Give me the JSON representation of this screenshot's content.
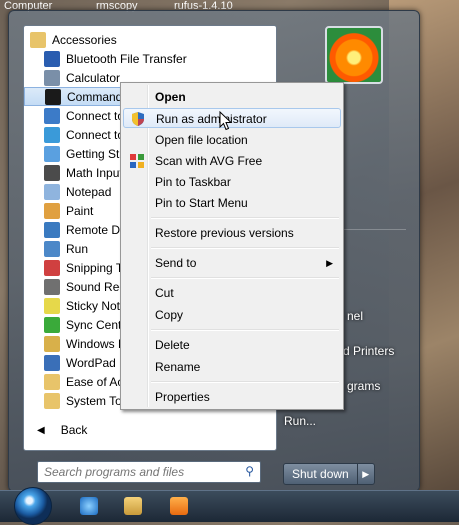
{
  "desktop": {
    "top_items": [
      "Computer",
      "rmscopy",
      "rufus-1.4.10"
    ]
  },
  "programs": [
    {
      "label": "Accessories",
      "icon": "folder-icon",
      "color": "#e8c46a"
    },
    {
      "label": "Bluetooth File Transfer",
      "icon": "bluetooth-icon",
      "color": "#2a5db0"
    },
    {
      "label": "Calculator",
      "icon": "calculator-icon",
      "color": "#7a8fa8"
    },
    {
      "label": "Command Prompt",
      "icon": "cmd-icon",
      "color": "#1a1a1a"
    },
    {
      "label": "Connect to",
      "icon": "network-projector-icon",
      "color": "#3c7bc8"
    },
    {
      "label": "Connect to",
      "icon": "remote-display-icon",
      "color": "#3a9ad9"
    },
    {
      "label": "Getting Star",
      "icon": "getting-started-icon",
      "color": "#5aa0e0"
    },
    {
      "label": "Math Input",
      "icon": "math-input-icon",
      "color": "#4b4b4b"
    },
    {
      "label": "Notepad",
      "icon": "notepad-icon",
      "color": "#8fb4de"
    },
    {
      "label": "Paint",
      "icon": "paint-icon",
      "color": "#e0a040"
    },
    {
      "label": "Remote Des",
      "icon": "remote-desktop-icon",
      "color": "#3a7ac0"
    },
    {
      "label": "Run",
      "icon": "run-icon",
      "color": "#4c88c8"
    },
    {
      "label": "Snipping To",
      "icon": "snipping-tool-icon",
      "color": "#d04040"
    },
    {
      "label": "Sound Reco",
      "icon": "microphone-icon",
      "color": "#707070"
    },
    {
      "label": "Sticky Note",
      "icon": "sticky-notes-icon",
      "color": "#e6d84a"
    },
    {
      "label": "Sync Center",
      "icon": "sync-center-icon",
      "color": "#3aaa3a"
    },
    {
      "label": "Windows Ex",
      "icon": "windows-explorer-icon",
      "color": "#d8b04a"
    },
    {
      "label": "WordPad",
      "icon": "wordpad-icon",
      "color": "#3a6fb8"
    },
    {
      "label": "Ease of Acc",
      "icon": "folder-icon",
      "color": "#e8c46a"
    },
    {
      "label": "System Too",
      "icon": "folder-icon",
      "color": "#e8c46a"
    }
  ],
  "back_label": "Back",
  "search": {
    "placeholder": "Search programs and files"
  },
  "right_pane": {
    "items": [
      "nel",
      "d Printers",
      "grams",
      "Run..."
    ]
  },
  "shutdown": {
    "label": "Shut down"
  },
  "context_menu": {
    "items": [
      {
        "label": "Open",
        "bold": true
      },
      {
        "label": "Run as administrator",
        "icon": "uac-shield-icon",
        "hover": true
      },
      {
        "label": "Open file location"
      },
      {
        "label": "Scan with AVG Free",
        "icon": "avg-icon"
      },
      {
        "label": "Pin to Taskbar"
      },
      {
        "label": "Pin to Start Menu"
      },
      {
        "label": "Restore previous versions"
      },
      {
        "label": "Send to",
        "submenu": true
      },
      {
        "label": "Cut"
      },
      {
        "label": "Copy"
      },
      {
        "label": "Delete"
      },
      {
        "label": "Rename"
      },
      {
        "label": "Properties"
      }
    ]
  }
}
